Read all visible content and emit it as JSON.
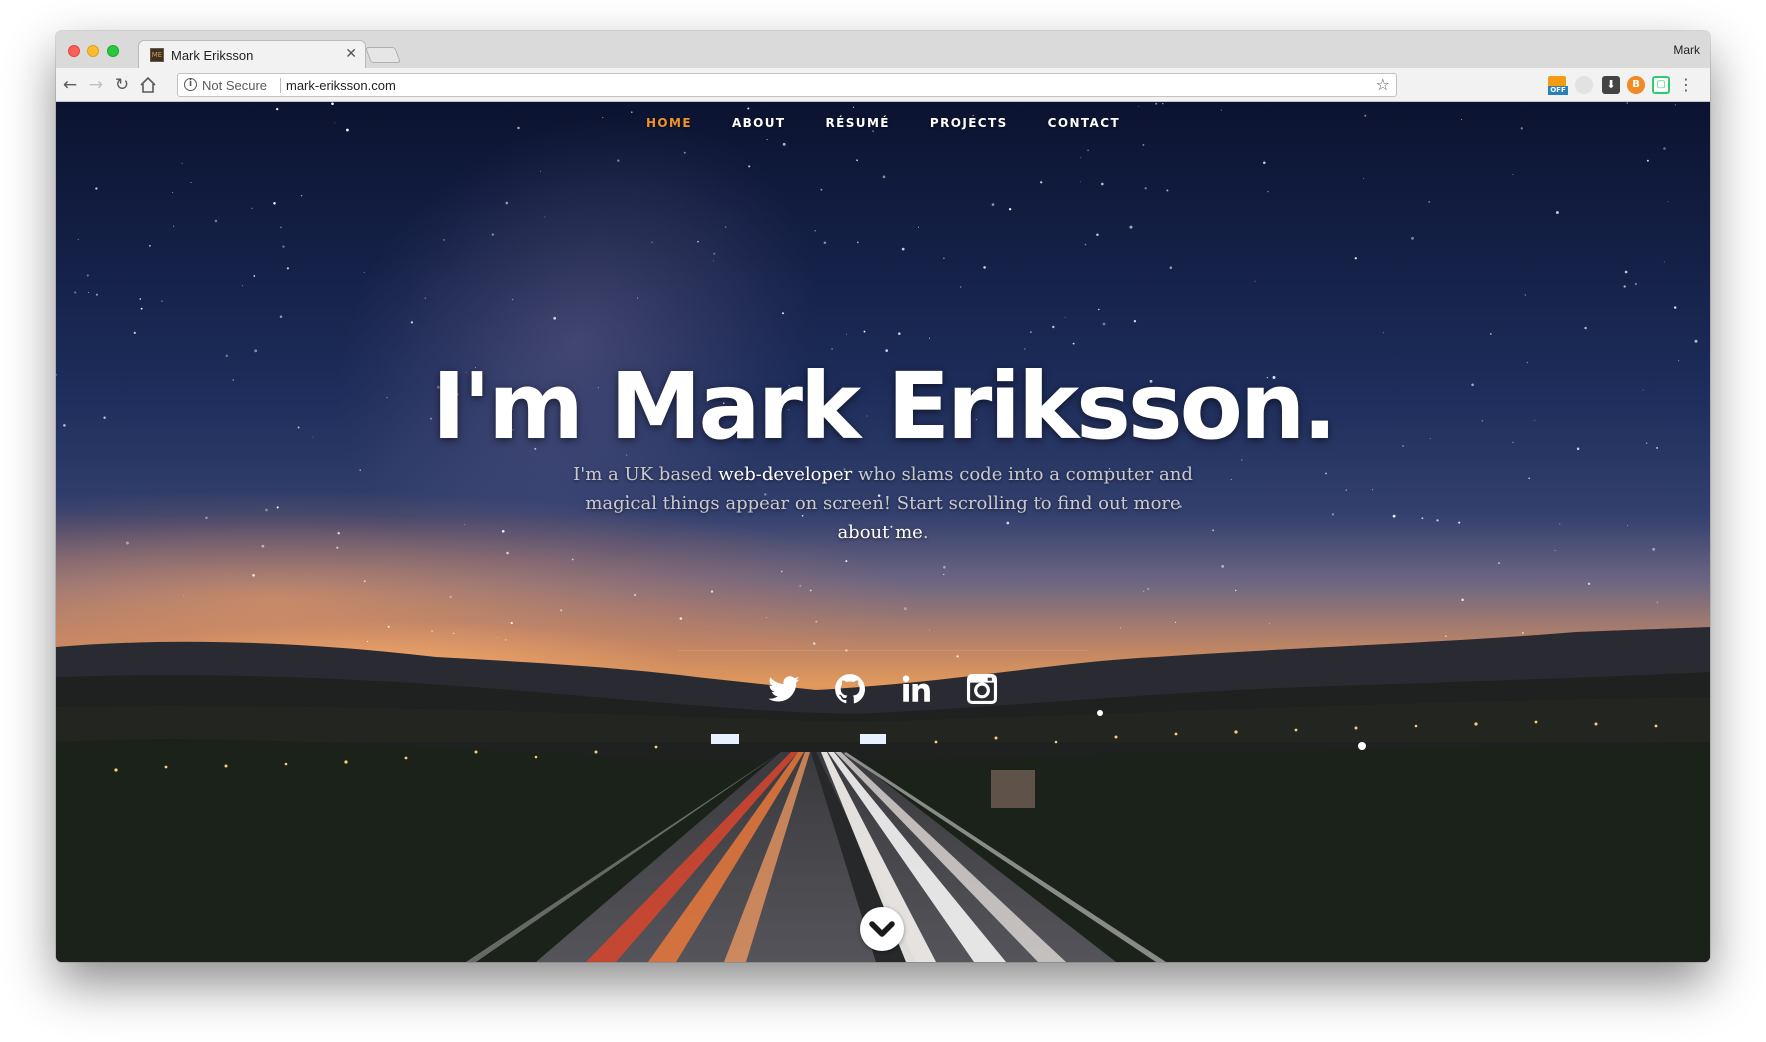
{
  "browser": {
    "tab_title": "Mark Eriksson",
    "tab_favicon_text": "ME",
    "profile_name": "Mark",
    "security_label": "Not Secure",
    "url": "mark-eriksson.com",
    "ext_off_label": "OFF",
    "ext_b_label": "B"
  },
  "nav": {
    "items": [
      {
        "label": "HOME",
        "active": true
      },
      {
        "label": "ABOUT"
      },
      {
        "label": "RÉSUMÉ"
      },
      {
        "label": "PROJECTS"
      },
      {
        "label": "CONTACT"
      }
    ]
  },
  "hero": {
    "title": "I'm Mark Eriksson.",
    "text_part1": "I'm a UK based ",
    "text_emphasis": "web-developer",
    "text_part2": " who slams code into a computer and magical things appear on screen! Start scrolling to find out more ",
    "text_emphasis2": "about me",
    "text_part3": "."
  },
  "socials": [
    {
      "icon": "twitter-icon"
    },
    {
      "icon": "github-icon"
    },
    {
      "icon": "linkedin-icon"
    },
    {
      "icon": "instagram-icon"
    }
  ],
  "colors": {
    "accent": "#f2912b",
    "nav_text": "#ffffff"
  }
}
